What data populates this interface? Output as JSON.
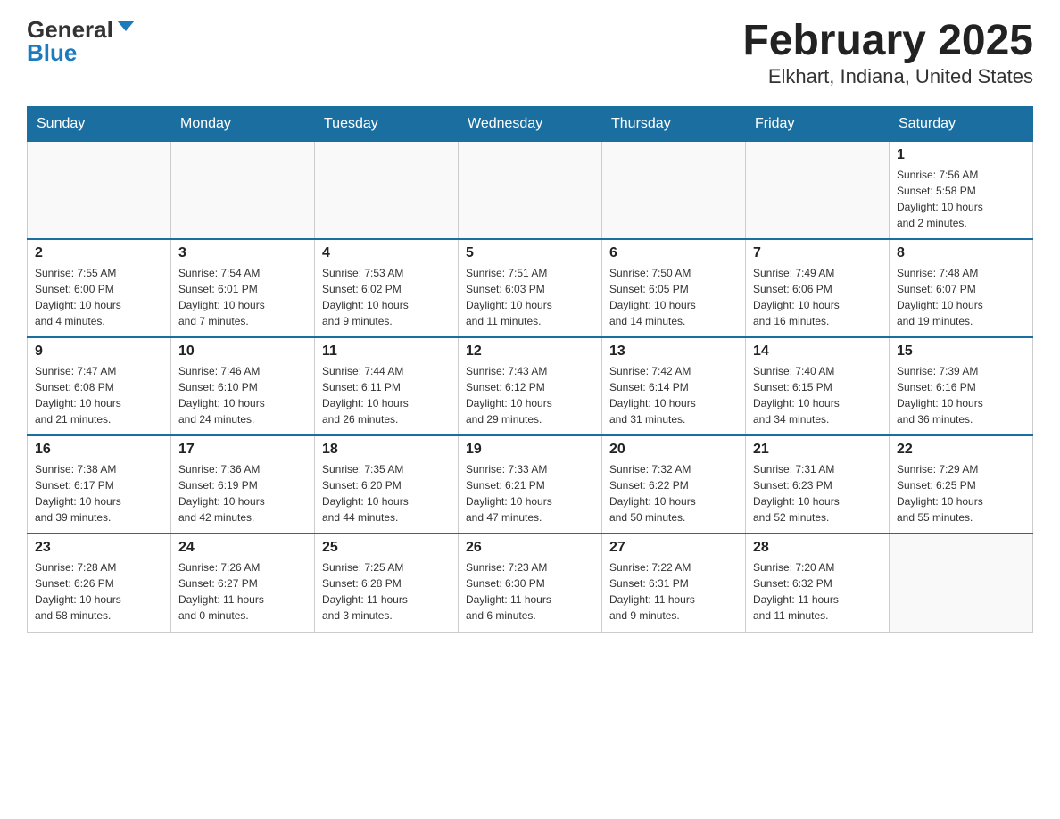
{
  "logo": {
    "general": "General",
    "blue": "Blue"
  },
  "title": "February 2025",
  "subtitle": "Elkhart, Indiana, United States",
  "days_of_week": [
    "Sunday",
    "Monday",
    "Tuesday",
    "Wednesday",
    "Thursday",
    "Friday",
    "Saturday"
  ],
  "weeks": [
    [
      {
        "day": "",
        "info": ""
      },
      {
        "day": "",
        "info": ""
      },
      {
        "day": "",
        "info": ""
      },
      {
        "day": "",
        "info": ""
      },
      {
        "day": "",
        "info": ""
      },
      {
        "day": "",
        "info": ""
      },
      {
        "day": "1",
        "info": "Sunrise: 7:56 AM\nSunset: 5:58 PM\nDaylight: 10 hours\nand 2 minutes."
      }
    ],
    [
      {
        "day": "2",
        "info": "Sunrise: 7:55 AM\nSunset: 6:00 PM\nDaylight: 10 hours\nand 4 minutes."
      },
      {
        "day": "3",
        "info": "Sunrise: 7:54 AM\nSunset: 6:01 PM\nDaylight: 10 hours\nand 7 minutes."
      },
      {
        "day": "4",
        "info": "Sunrise: 7:53 AM\nSunset: 6:02 PM\nDaylight: 10 hours\nand 9 minutes."
      },
      {
        "day": "5",
        "info": "Sunrise: 7:51 AM\nSunset: 6:03 PM\nDaylight: 10 hours\nand 11 minutes."
      },
      {
        "day": "6",
        "info": "Sunrise: 7:50 AM\nSunset: 6:05 PM\nDaylight: 10 hours\nand 14 minutes."
      },
      {
        "day": "7",
        "info": "Sunrise: 7:49 AM\nSunset: 6:06 PM\nDaylight: 10 hours\nand 16 minutes."
      },
      {
        "day": "8",
        "info": "Sunrise: 7:48 AM\nSunset: 6:07 PM\nDaylight: 10 hours\nand 19 minutes."
      }
    ],
    [
      {
        "day": "9",
        "info": "Sunrise: 7:47 AM\nSunset: 6:08 PM\nDaylight: 10 hours\nand 21 minutes."
      },
      {
        "day": "10",
        "info": "Sunrise: 7:46 AM\nSunset: 6:10 PM\nDaylight: 10 hours\nand 24 minutes."
      },
      {
        "day": "11",
        "info": "Sunrise: 7:44 AM\nSunset: 6:11 PM\nDaylight: 10 hours\nand 26 minutes."
      },
      {
        "day": "12",
        "info": "Sunrise: 7:43 AM\nSunset: 6:12 PM\nDaylight: 10 hours\nand 29 minutes."
      },
      {
        "day": "13",
        "info": "Sunrise: 7:42 AM\nSunset: 6:14 PM\nDaylight: 10 hours\nand 31 minutes."
      },
      {
        "day": "14",
        "info": "Sunrise: 7:40 AM\nSunset: 6:15 PM\nDaylight: 10 hours\nand 34 minutes."
      },
      {
        "day": "15",
        "info": "Sunrise: 7:39 AM\nSunset: 6:16 PM\nDaylight: 10 hours\nand 36 minutes."
      }
    ],
    [
      {
        "day": "16",
        "info": "Sunrise: 7:38 AM\nSunset: 6:17 PM\nDaylight: 10 hours\nand 39 minutes."
      },
      {
        "day": "17",
        "info": "Sunrise: 7:36 AM\nSunset: 6:19 PM\nDaylight: 10 hours\nand 42 minutes."
      },
      {
        "day": "18",
        "info": "Sunrise: 7:35 AM\nSunset: 6:20 PM\nDaylight: 10 hours\nand 44 minutes."
      },
      {
        "day": "19",
        "info": "Sunrise: 7:33 AM\nSunset: 6:21 PM\nDaylight: 10 hours\nand 47 minutes."
      },
      {
        "day": "20",
        "info": "Sunrise: 7:32 AM\nSunset: 6:22 PM\nDaylight: 10 hours\nand 50 minutes."
      },
      {
        "day": "21",
        "info": "Sunrise: 7:31 AM\nSunset: 6:23 PM\nDaylight: 10 hours\nand 52 minutes."
      },
      {
        "day": "22",
        "info": "Sunrise: 7:29 AM\nSunset: 6:25 PM\nDaylight: 10 hours\nand 55 minutes."
      }
    ],
    [
      {
        "day": "23",
        "info": "Sunrise: 7:28 AM\nSunset: 6:26 PM\nDaylight: 10 hours\nand 58 minutes."
      },
      {
        "day": "24",
        "info": "Sunrise: 7:26 AM\nSunset: 6:27 PM\nDaylight: 11 hours\nand 0 minutes."
      },
      {
        "day": "25",
        "info": "Sunrise: 7:25 AM\nSunset: 6:28 PM\nDaylight: 11 hours\nand 3 minutes."
      },
      {
        "day": "26",
        "info": "Sunrise: 7:23 AM\nSunset: 6:30 PM\nDaylight: 11 hours\nand 6 minutes."
      },
      {
        "day": "27",
        "info": "Sunrise: 7:22 AM\nSunset: 6:31 PM\nDaylight: 11 hours\nand 9 minutes."
      },
      {
        "day": "28",
        "info": "Sunrise: 7:20 AM\nSunset: 6:32 PM\nDaylight: 11 hours\nand 11 minutes."
      },
      {
        "day": "",
        "info": ""
      }
    ]
  ]
}
